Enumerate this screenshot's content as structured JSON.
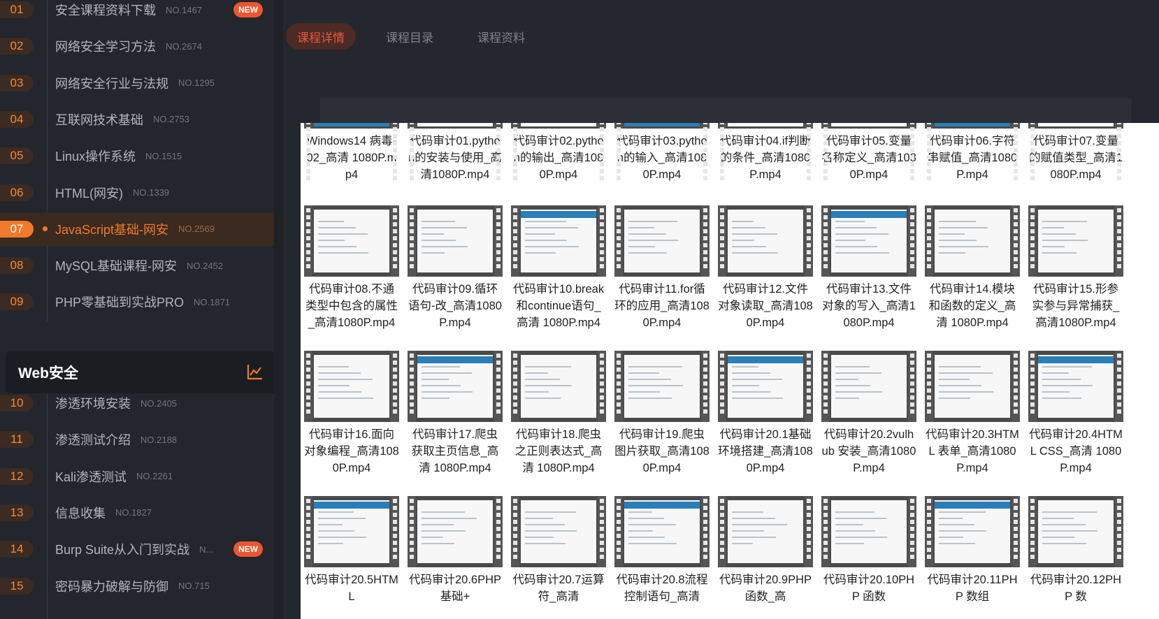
{
  "sidebar": {
    "items": [
      {
        "num": "01",
        "title": "安全课程资料下载",
        "no": "NO.1467",
        "badge": "NEW"
      },
      {
        "num": "02",
        "title": "网络安全学习方法",
        "no": "NO.2674"
      },
      {
        "num": "03",
        "title": "网络安全行业与法规",
        "no": "NO.1295"
      },
      {
        "num": "04",
        "title": "互联网技术基础",
        "no": "NO.2753"
      },
      {
        "num": "05",
        "title": "Linux操作系统",
        "no": "NO.1515"
      },
      {
        "num": "06",
        "title": "HTML(网安)",
        "no": "NO.1339"
      },
      {
        "num": "07",
        "title": "JavaScript基础-网安",
        "no": "NO.2569",
        "active": true
      },
      {
        "num": "08",
        "title": "MySQL基础课程-网安",
        "no": "NO.2452"
      },
      {
        "num": "09",
        "title": "PHP零基础到实战PRO",
        "no": "NO.1871"
      }
    ],
    "section": {
      "title": "Web安全",
      "icon": "chart-line-icon"
    },
    "items2": [
      {
        "num": "10",
        "title": "渗透环境安装",
        "no": "NO.2405"
      },
      {
        "num": "11",
        "title": "渗透测试介绍",
        "no": "NO.2188"
      },
      {
        "num": "12",
        "title": "Kali渗透测试",
        "no": "NO.2261"
      },
      {
        "num": "13",
        "title": "信息收集",
        "no": "NO.1827"
      },
      {
        "num": "14",
        "title": "Burp Suite从入门到实战",
        "no": "N...",
        "badge": "NEW"
      },
      {
        "num": "15",
        "title": "密码暴力破解与防御",
        "no": "NO.715"
      }
    ]
  },
  "tabs": [
    "课程详情",
    "课程目录",
    "课程资料"
  ],
  "files": [
    [
      "Windows14 病毒-02_高清 1080P.mp4",
      "代码审计01.python的安装与使用_高清1080P.mp4",
      "代码审计02.python的输出_高清1080P.mp4",
      "代码审计03.python的输入_高清1080P.mp4",
      "代码审计04.if判断的条件_高清1080P.mp4",
      "代码审计05.变量名称定义_高清1080P.mp4",
      "代码审计06.字符串赋值_高清1080P.mp4",
      "代码审计07.变量的赋值类型_高清1080P.mp4"
    ],
    [
      "代码审计08.不通类型中包含的属性_高清1080P.mp4",
      "代码审计09.循环语句-改_高清1080P.mp4",
      "代码审计10.break和continue语句_高清 1080P.mp4",
      "代码审计11.for循环的应用_高清1080P.mp4",
      "代码审计12.文件对象读取_高清1080P.mp4",
      "代码审计13.文件对象的写入_高清1080P.mp4",
      "代码审计14.模块和函数的定义_高清 1080P.mp4",
      "代码审计15.形参实参与异常捕获_高清1080P.mp4"
    ],
    [
      "代码审计16.面向对象编程_高清1080P.mp4",
      "代码审计17.爬虫获取主页信息_高清 1080P.mp4",
      "代码审计18.爬虫之正则表达式_高清 1080P.mp4",
      "代码审计19.爬虫图片获取_高清1080P.mp4",
      "代码审计20.1基础环境搭建_高清1080P.mp4",
      "代码审计20.2vulhub 安装_高清1080P.mp4",
      "代码审计20.3HTML 表单_高清1080P.mp4",
      "代码审计20.4HTML CSS_高清 1080P.mp4"
    ],
    [
      "代码审计20.5HTML",
      "代码审计20.6PHP 基础+",
      "代码审计20.7运算符_高清",
      "代码审计20.8流程控制语句_高清",
      "代码审计20.9PHP 函数_高",
      "代码审计20.10PHP 函数",
      "代码审计20.11PHP 数组",
      "代码审计20.12PHP 数"
    ]
  ]
}
